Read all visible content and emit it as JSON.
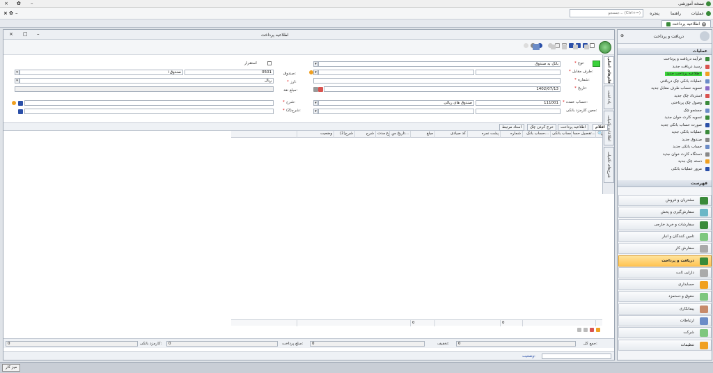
{
  "app": {
    "title": "نسخه آموزشی"
  },
  "menu": {
    "items": [
      "عملیات",
      "راهنما",
      "پنجره"
    ],
    "search_placeholder": "جستجو... (Ctrl+=)",
    "window_controls": [
      "×",
      "✿",
      "–"
    ]
  },
  "tab": {
    "label": "اطلاعیه پرداخت"
  },
  "window": {
    "title": "اطلاعیه پرداخت",
    "controls": [
      "–",
      "□",
      "×"
    ]
  },
  "form": {
    "type": {
      "label": "نوع:",
      "value": "بانک به صندوق"
    },
    "counterparty": {
      "label": "طرف مقابل:"
    },
    "number": {
      "label": "شماره:"
    },
    "date": {
      "label": "تاریخ:",
      "value": "1402/07/13"
    },
    "main_account": {
      "label": "حساب عمده:",
      "code": "111001",
      "name": "صندوق های ریالی"
    },
    "bank_fee_account": {
      "label": "معین کارمزد بانکی:"
    },
    "approved": {
      "label": "استقرار"
    },
    "fund": {
      "label": "صندوق:",
      "code": "0501",
      "name": "صندوق۱"
    },
    "currency": {
      "label": "ارز:",
      "value": "ریال"
    },
    "cash_amount": {
      "label": "مبلغ نقد:"
    },
    "desc": {
      "label": "شرح:"
    },
    "desc2": {
      "label": "شرح(2):"
    }
  },
  "vtabs": [
    "قلم‌های اصلی",
    "یادداشت",
    "اطلاعات تکمیلی",
    "شرح‌های تکمیلی"
  ],
  "subtabs": [
    "اقلام",
    "اطلاعیه پرداخت",
    "خرج کردن چک",
    "اسناد مرتبط"
  ],
  "grid": {
    "columns": [
      "تفصیل حسا...",
      "حساب بانکی",
      "حساب بانک...",
      "شماره",
      "پشت نمره",
      "کد صیادی",
      "مبلغ",
      "تاریخ س...",
      "نوع مدت",
      "شرح",
      "شرح(2)",
      "وضعیت"
    ],
    "footer_amount": "0",
    "footer_number": "0"
  },
  "totals": {
    "total_label": "جمع کل:",
    "total_value": "0",
    "discount_label": "تخفیف:",
    "discount_value": "0",
    "paid_label": "مبلغ پرداخت:",
    "paid_value": "0",
    "fee_label": "کارمزد بانکی:",
    "fee_value": "0"
  },
  "status": {
    "label": "وضعیت:"
  },
  "rightpanel": {
    "title": "دریافت و پرداخت",
    "ops_title": "عملیات",
    "ops": [
      "فرآیند دریافت و پرداخت",
      "رسید دریافت جدید",
      "اطلاعیه پرداخت جدید",
      "عملیات بانکی چک دریافتی",
      "تسویه حساب طرف مقابل جدید",
      "استرداد چک جدید",
      "وصول چک پرداختی",
      "جستجو چک",
      "تسویه کارت خوان جدید",
      "صورت حساب بانکی جدید",
      "عملیات بانکی جدید",
      "صندوق جدید",
      "حساب بانکی جدید",
      "دستگاه کارت خوان جدید",
      "دسته چک جدید",
      "مرور عملیات بانکی"
    ],
    "list_title": "فهرست",
    "nav": [
      "مشتریان و فروش",
      "سفارش‌گیری و پخش",
      "سفارشات و خرید خارجی",
      "تامین کنندگان و انبار",
      "سفارش کار",
      "دریافت و پرداخت",
      "دارایی ثابت",
      "حسابداری",
      "حقوق و دستمزد",
      "پیمانکاری",
      "ارتباطات",
      "شرکت",
      "تنظیمات"
    ]
  },
  "bottom": {
    "workspace_button": "میز کار"
  },
  "colors": {
    "accent": "#ffc455",
    "highlight": "#3bd23b"
  }
}
